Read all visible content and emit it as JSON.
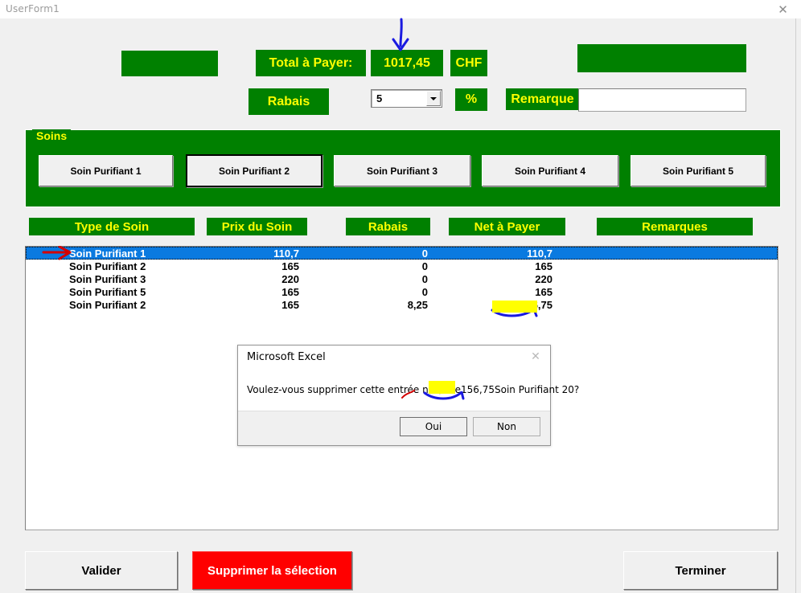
{
  "window": {
    "title": "UserForm1",
    "close_icon": "close-icon"
  },
  "header": {
    "total_label": "Total à Payer:",
    "total_amount": "1017,45",
    "currency": "CHF",
    "rabais_label": "Rabais",
    "rabais_value": "5",
    "rabais_options": [
      "5"
    ],
    "percent_label": "%",
    "remarque_label": "Remarque",
    "remarque_value": "",
    "remarque_placeholder": ""
  },
  "soins_frame": {
    "caption": "Soins",
    "buttons": [
      {
        "label": "Soin Purifiant 1",
        "focused": false
      },
      {
        "label": "Soin Purifiant 2",
        "focused": true
      },
      {
        "label": "Soin Purifiant 3",
        "focused": false
      },
      {
        "label": "Soin Purifiant 4",
        "focused": false
      },
      {
        "label": "Soin Purifiant 5",
        "focused": false
      }
    ]
  },
  "table": {
    "headers": [
      "Type de Soin",
      "Prix du Soin",
      "Rabais",
      "Net à Payer",
      "Remarques"
    ],
    "rows": [
      {
        "type": "Soin Purifiant 1",
        "prix": "110,7",
        "rabais": "0",
        "net": "110,7",
        "remarque": "",
        "selected": true,
        "highlighted": false
      },
      {
        "type": "Soin Purifiant 2",
        "prix": "165",
        "rabais": "0",
        "net": "165",
        "remarque": "",
        "selected": false,
        "highlighted": false
      },
      {
        "type": "Soin Purifiant 3",
        "prix": "220",
        "rabais": "0",
        "net": "220",
        "remarque": "",
        "selected": false,
        "highlighted": false
      },
      {
        "type": "Soin Purifiant 5",
        "prix": "165",
        "rabais": "0",
        "net": "165",
        "remarque": "",
        "selected": false,
        "highlighted": false
      },
      {
        "type": "Soin Purifiant 2",
        "prix": "165",
        "rabais": "8,25",
        "net": "156,75",
        "remarque": "",
        "selected": false,
        "highlighted": true
      }
    ]
  },
  "footer": {
    "valider_label": "Valider",
    "supprimer_label": "Supprimer la sélection",
    "terminer_label": "Terminer"
  },
  "dialog": {
    "title": "Microsoft Excel",
    "close_icon": "close-icon",
    "message": "Voulez-vous supprimer cette entrée n°0/5de156,75Soin Purifiant 20?",
    "message_parts": {
      "before": "Voulez-vous supprimer cette entrée n°",
      "index": "0",
      "middle": "/5de",
      "amount": "156,75",
      "after": "Soin Purifiant 20?"
    },
    "yes_label": "Oui",
    "no_label": "Non"
  },
  "annotations": {
    "blue_arrow_top": "blue-arrow-pointing-to-total",
    "red_arrow_row": "red-arrow-pointing-to-selected-row",
    "yellow_highlight_net": "yellow-highlight-on-156-75",
    "blue_underline_net": "blue-underline-on-156-75",
    "red_mark_dialog": "red-mark-under-index-0",
    "blue_underline_dialog": "blue-underline-under-amount"
  },
  "colors": {
    "green": "#008000",
    "yellow_text": "#ffff00",
    "selection_blue": "#0a7ae0",
    "highlight_yellow": "#ffff00",
    "danger_red": "#ff0000",
    "form_background": "#f0f0f0"
  }
}
